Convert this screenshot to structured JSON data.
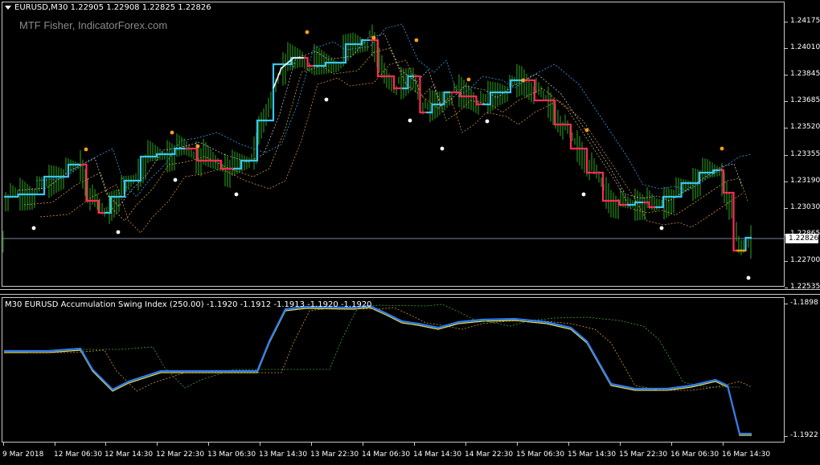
{
  "main_chart": {
    "symbol_header": "EURUSD,M30  1.22905 1.22908 1.22825 1.22826",
    "watermark": "MTF Fisher, IndicatorForex.com",
    "current_price": "1.22826",
    "price_axis": [
      "1.24175",
      "1.24010",
      "1.23845",
      "1.23685",
      "1.23520",
      "1.23355",
      "1.23190",
      "1.23030",
      "1.22865",
      "1.22700",
      "1.22535"
    ]
  },
  "indicator_chart": {
    "header": "M30 EURUSD Accumulation Swing Index (250.00) -1.1920 -1.1912 -1.1913 -1.1920 -1.1920",
    "axis": [
      "-1.1898",
      "-1.1922"
    ]
  },
  "time_axis": [
    "9 Mar 2018",
    "12 Mar 06:30",
    "12 Mar 14:30",
    "12 Mar 22:30",
    "13 Mar 06:30",
    "13 Mar 14:30",
    "13 Mar 22:30",
    "14 Mar 06:30",
    "14 Mar 14:30",
    "14 Mar 22:30",
    "15 Mar 06:30",
    "15 Mar 14:30",
    "15 Mar 22:30",
    "16 Mar 06:30",
    "16 Mar 14:30"
  ],
  "colors": {
    "bars": "#2ea81e",
    "fisher_up": "#38c6ee",
    "fisher_down": "#ff2b57",
    "fisher_flat": "#ffffff",
    "dots_high": "#ff9f1a",
    "dots_low": "#ffffff",
    "asi_main": "#2f7df2",
    "asi_signal": "#e8e35a",
    "asi_trail": "#d29a2e",
    "asi_trail2": "#3aa33a"
  }
}
